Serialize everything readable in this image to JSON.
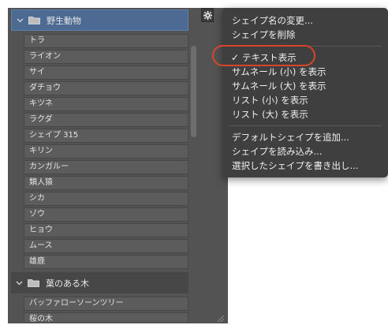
{
  "groups": [
    {
      "label": "野生動物",
      "items": [
        "トラ",
        "ライオン",
        "サイ",
        "ダチョウ",
        "キツネ",
        "ラクダ",
        "シェイプ 315",
        "キリン",
        "カンガルー",
        "類人猿",
        "シカ",
        "ゾウ",
        "ヒョウ",
        "ムース",
        "雄鹿"
      ]
    },
    {
      "label": "葉のある木",
      "items": [
        "バッファローソーンツリー",
        "桜の木"
      ]
    }
  ],
  "menu": {
    "rename": "シェイプ名の変更...",
    "delete": "シェイプを削除",
    "text_view": "テキスト表示",
    "check_mark": "✓",
    "small_thumb": "サムネール (小) を表示",
    "large_thumb": "サムネール (大) を表示",
    "small_list": "リスト (小) を表示",
    "large_list": "リスト (大) を表示",
    "add_default": "デフォルトシェイプを追加...",
    "load": "シェイプを読み込み...",
    "export": "選択したシェイプを書き出し..."
  },
  "colors": {
    "selection": "#4c6a92",
    "highlight_ring": "#d9452b",
    "panel_bg": "#535353",
    "menu_bg": "#3f3f3f"
  }
}
